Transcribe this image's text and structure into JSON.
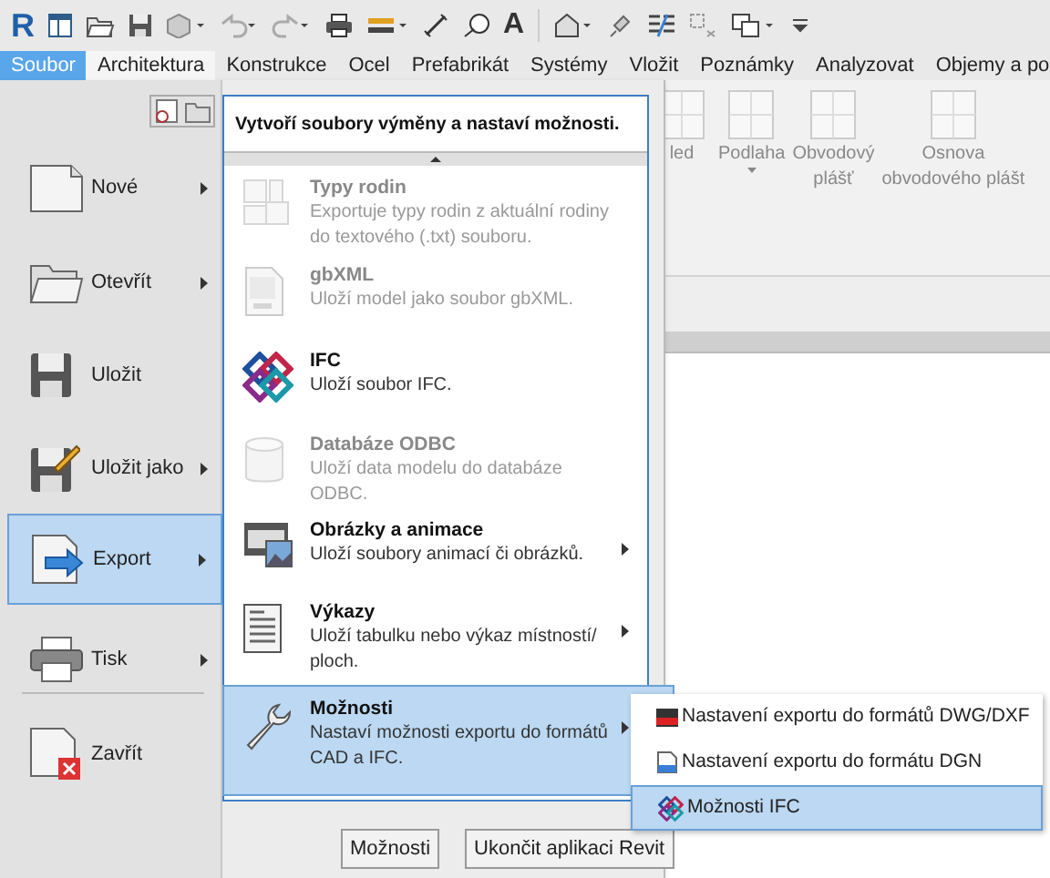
{
  "app_logo": "R",
  "toolbar_text_tool": "A",
  "ribbon_tabs": [
    {
      "label": "Soubor",
      "selected": true
    },
    {
      "label": "Architektura",
      "selected": false
    },
    {
      "label": "Konstrukce",
      "selected": false
    },
    {
      "label": "Ocel",
      "selected": false
    },
    {
      "label": "Prefabrikát",
      "selected": false
    },
    {
      "label": "Systémy",
      "selected": false
    },
    {
      "label": "Vložit",
      "selected": false
    },
    {
      "label": "Poznámky",
      "selected": false
    },
    {
      "label": "Analyzovat",
      "selected": false
    },
    {
      "label": "Objemy a po",
      "selected": false
    }
  ],
  "ribbon_buttons": [
    {
      "label": "led",
      "dropdown": false
    },
    {
      "label": "Podlaha",
      "dropdown": true
    },
    {
      "label": "Obvodový plášť",
      "dropdown": false
    },
    {
      "label": "Osnova obvodového plášt",
      "dropdown": false
    }
  ],
  "app_menu": {
    "items": [
      {
        "label": "Nové",
        "submenu": true,
        "selected": false
      },
      {
        "label": "Otevřít",
        "submenu": true,
        "selected": false
      },
      {
        "label": "Uložit",
        "submenu": false,
        "selected": false
      },
      {
        "label": "Uložit jako",
        "submenu": true,
        "selected": false
      },
      {
        "label": "Export",
        "submenu": true,
        "selected": true
      },
      {
        "label": "Tisk",
        "submenu": true,
        "selected": false
      },
      {
        "label": "Zavřít",
        "submenu": false,
        "selected": false
      }
    ],
    "submenu": {
      "header": "Vytvoří soubory výměny a nastaví možnosti.",
      "items": [
        {
          "title": "Typy rodin",
          "description": "Exportuje typy rodin z aktuální rodiny do textového (.txt) souboru.",
          "disabled": true,
          "submenu": false,
          "selected": false
        },
        {
          "title": "gbXML",
          "description": "Uloží model jako soubor gbXML.",
          "disabled": true,
          "submenu": false,
          "selected": false
        },
        {
          "title": "IFC",
          "description": "Uloží soubor IFC.",
          "disabled": false,
          "submenu": false,
          "selected": false
        },
        {
          "title": "Databáze ODBC",
          "description": "Uloží data modelu do databáze ODBC.",
          "disabled": true,
          "submenu": false,
          "selected": false
        },
        {
          "title": "Obrázky a animace",
          "description": "Uloží soubory animací či obrázků.",
          "disabled": false,
          "submenu": true,
          "selected": false
        },
        {
          "title": "Výkazy",
          "description": "Uloží tabulku nebo výkaz místností/ ploch.",
          "disabled": false,
          "submenu": true,
          "selected": false
        },
        {
          "title": "Možnosti",
          "description": "Nastaví možnosti exportu do formátů CAD a IFC.",
          "disabled": false,
          "submenu": true,
          "selected": true
        }
      ]
    },
    "buttons": [
      "Možnosti",
      "Ukončit aplikaci Revit"
    ]
  },
  "flyout": {
    "items": [
      {
        "label": "Nastavení exportu do formátů DWG/DXF",
        "selected": false
      },
      {
        "label": "Nastavení exportu do formátu DGN",
        "selected": false
      },
      {
        "label": "Možnosti IFC",
        "selected": true
      }
    ]
  }
}
